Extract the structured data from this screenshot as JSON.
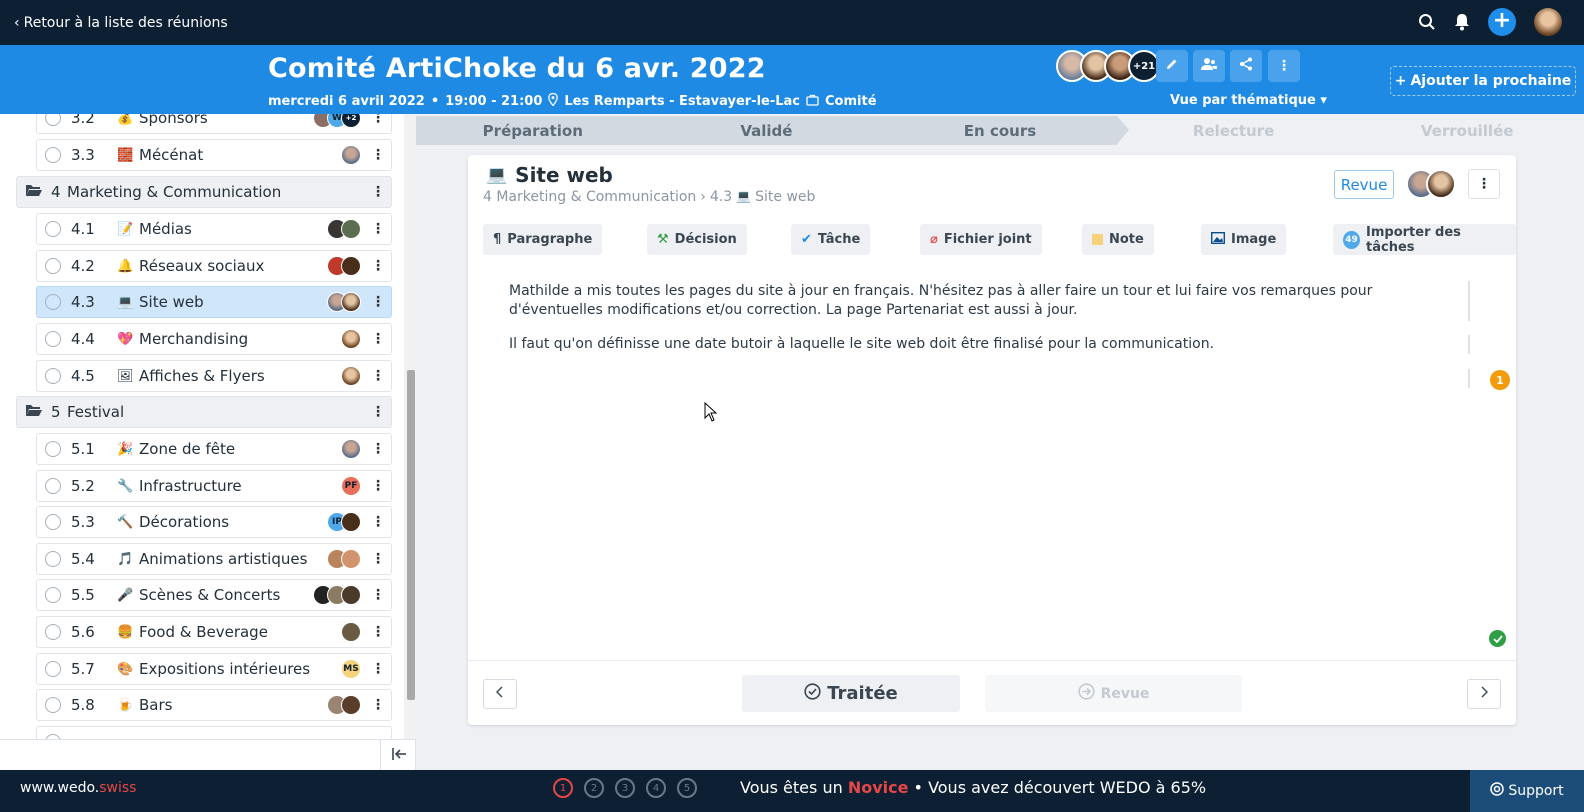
{
  "topbar": {
    "back_label": "Retour à la liste des réunions"
  },
  "header": {
    "title": "Comité ArtiChoke du 6 avr. 2022",
    "date": "mercredi 6 avril 2022",
    "time": "19:00 - 21:00",
    "location": "Les Remparts - Estavayer-le-Lac",
    "type": "Comité",
    "participants_more": "+21",
    "view_label": "Vue par thématique",
    "add_next_label": "Ajouter la prochaine"
  },
  "sidebar": {
    "items": [
      {
        "num": "3.2",
        "emoji": "💰",
        "label": "Sponsors",
        "kind": "item"
      },
      {
        "num": "3.3",
        "emoji": "🧱",
        "label": "Mécénat",
        "kind": "item"
      },
      {
        "num": "4",
        "emoji": "",
        "label": "Marketing & Communication",
        "kind": "group"
      },
      {
        "num": "4.1",
        "emoji": "📝",
        "label": "Médias",
        "kind": "item"
      },
      {
        "num": "4.2",
        "emoji": "🔔",
        "label": "Réseaux sociaux",
        "kind": "item"
      },
      {
        "num": "4.3",
        "emoji": "💻",
        "label": "Site web",
        "kind": "item",
        "selected": true
      },
      {
        "num": "4.4",
        "emoji": "💖",
        "label": "Merchandising",
        "kind": "item"
      },
      {
        "num": "4.5",
        "emoji": "🖼",
        "label": "Affiches & Flyers",
        "kind": "item"
      },
      {
        "num": "5",
        "emoji": "",
        "label": "Festival",
        "kind": "group"
      },
      {
        "num": "5.1",
        "emoji": "🎉",
        "label": "Zone de fête",
        "kind": "item"
      },
      {
        "num": "5.2",
        "emoji": "🔧",
        "label": "Infrastructure",
        "kind": "item",
        "initials": "PF"
      },
      {
        "num": "5.3",
        "emoji": "🔨",
        "label": "Décorations",
        "kind": "item",
        "initials": "IP"
      },
      {
        "num": "5.4",
        "emoji": "🎵",
        "label": "Animations artistiques",
        "kind": "item"
      },
      {
        "num": "5.5",
        "emoji": "🎤",
        "label": "Scènes & Concerts",
        "kind": "item"
      },
      {
        "num": "5.6",
        "emoji": "🍔",
        "label": "Food & Beverage",
        "kind": "item"
      },
      {
        "num": "5.7",
        "emoji": "🎨",
        "label": "Expositions intérieures",
        "kind": "item",
        "initials": "MS"
      },
      {
        "num": "5.8",
        "emoji": "🍺",
        "label": "Bars",
        "kind": "item"
      }
    ],
    "sponsor_avatar_letter": "W",
    "sponsor_more": "+2"
  },
  "steps": [
    "Préparation",
    "Validé",
    "En cours",
    "Relecture",
    "Verrouillée"
  ],
  "card": {
    "title": "Site web",
    "breadcrumb_section": "4 Marketing & Communication",
    "breadcrumb_num": "4.3",
    "breadcrumb_item": "Site web",
    "review_label": "Revue",
    "toolbar": [
      "Paragraphe",
      "Décision",
      "Tâche",
      "Fichier joint",
      "Note",
      "Image",
      "Importer des tâches"
    ],
    "import_count": "49",
    "paragraphs": [
      "Mathilde a mis toutes les pages du site à jour en français. N'hésitez pas à aller faire un tour et lui faire vos remarques pour d'éventuelles modifications et/ou correction. La page Partenariat est aussi à jour.",
      "Il faut qu'on définisse une date butoir à laquelle le site web doit être finalisé pour la communication."
    ],
    "comment_count": "1",
    "done_label": "Traitée",
    "review_action_label": "Revue"
  },
  "footer": {
    "brand_main": "www.wedo.",
    "brand_suffix": "swiss",
    "pages": [
      "1",
      "2",
      "3",
      "4",
      "5"
    ],
    "progress_pre": "Vous êtes un ",
    "progress_level": "Novice",
    "progress_post": " • Vous avez découvert WEDO à 65%",
    "support_label": "Support"
  },
  "colors": {
    "navy": "#0d2033",
    "blue": "#1f8ae3",
    "red": "#e74646",
    "orange": "#f29b0b",
    "green": "#2f9e45"
  }
}
